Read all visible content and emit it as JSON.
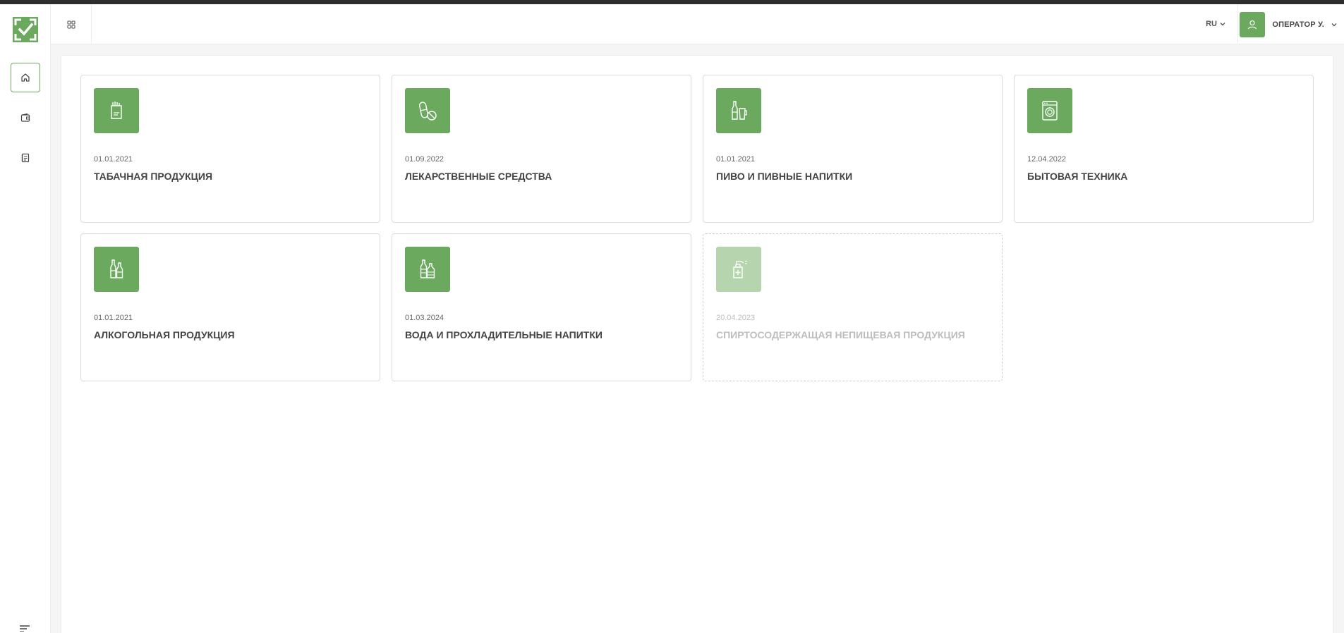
{
  "header": {
    "language": "RU",
    "user_name": "ОПЕРАТОР У."
  },
  "sidebar": {
    "items": [
      {
        "icon": "home-icon",
        "active": true
      },
      {
        "icon": "wallet-icon",
        "active": false
      },
      {
        "icon": "document-list-icon",
        "active": false
      }
    ]
  },
  "colors": {
    "accent": "#6aa95e",
    "accent_disabled": "#b6d5ae"
  },
  "categories": [
    {
      "date": "01.01.2021",
      "title": "ТАБАЧНАЯ ПРОДУКЦИЯ",
      "icon": "tobacco-pack-icon",
      "enabled": true
    },
    {
      "date": "01.09.2022",
      "title": "ЛЕКАРСТВЕННЫЕ СРЕДСТВА",
      "icon": "pill-icon",
      "enabled": true
    },
    {
      "date": "01.01.2021",
      "title": "ПИВО И ПИВНЫЕ НАПИТКИ",
      "icon": "beer-bottle-icon",
      "enabled": true
    },
    {
      "date": "12.04.2022",
      "title": "БЫТОВАЯ ТЕХНИКА",
      "icon": "washing-machine-icon",
      "enabled": true
    },
    {
      "date": "01.01.2021",
      "title": "АЛКОГОЛЬНАЯ ПРОДУКЦИЯ",
      "icon": "wine-bottles-icon",
      "enabled": true
    },
    {
      "date": "01.03.2024",
      "title": "ВОДА И ПРОХЛАДИТЕЛЬНЫЕ НАПИТКИ",
      "icon": "water-bottles-icon",
      "enabled": true
    },
    {
      "date": "20.04.2023",
      "title": "СПИРТОСОДЕРЖАЩАЯ НЕПИЩЕВАЯ ПРОДУКЦИЯ",
      "icon": "spray-bottle-icon",
      "enabled": false
    }
  ]
}
